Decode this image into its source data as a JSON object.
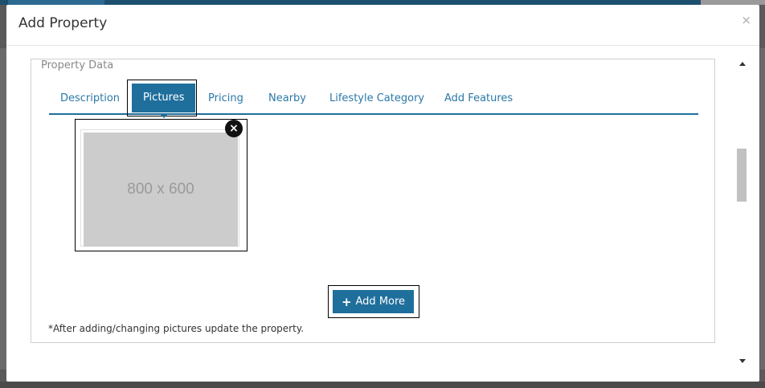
{
  "modal": {
    "title": "Add Property",
    "close": "×"
  },
  "fieldset": {
    "legend": "Property Data"
  },
  "tabs": [
    {
      "label": "Description"
    },
    {
      "label": "Pictures",
      "active": true
    },
    {
      "label": "Pricing"
    },
    {
      "label": "Nearby"
    },
    {
      "label": "Lifestyle Category"
    },
    {
      "label": "Add Features"
    }
  ],
  "picture": {
    "placeholder_text": "800 x 600",
    "remove_icon": "×"
  },
  "add_more": {
    "icon": "+",
    "label": "Add More"
  },
  "note": "*After adding/changing pictures update the property.",
  "colors": {
    "accent": "#1f6f9c",
    "link": "#2b78a8",
    "placeholder_bg": "#cccccc"
  }
}
